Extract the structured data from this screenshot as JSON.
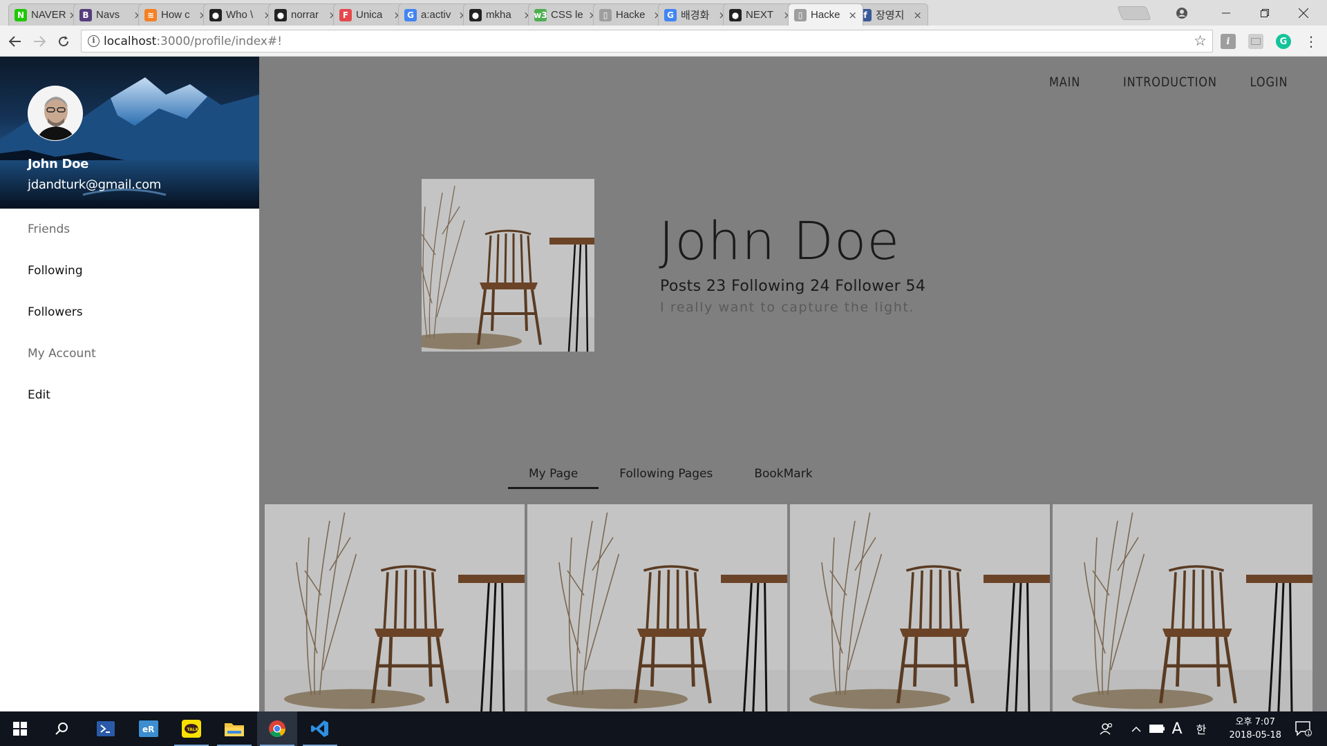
{
  "browser": {
    "tabs": [
      {
        "title": "NAVER",
        "favicon_text": "N",
        "favicon_color": "#1ec800"
      },
      {
        "title": "Navs",
        "favicon_text": "B",
        "favicon_color": "#563d7c"
      },
      {
        "title": "How c",
        "favicon_text": "≋",
        "favicon_color": "#f48024"
      },
      {
        "title": "Who \\",
        "favicon_text": "●",
        "favicon_color": "#222222"
      },
      {
        "title": "norrar",
        "favicon_text": "●",
        "favicon_color": "#222222"
      },
      {
        "title": "Unica",
        "favicon_text": "F",
        "favicon_color": "#e5484d"
      },
      {
        "title": "a:activ",
        "favicon_text": "G",
        "favicon_color": "#4285f4"
      },
      {
        "title": "mkha",
        "favicon_text": "●",
        "favicon_color": "#222222"
      },
      {
        "title": "CSS le",
        "favicon_text": "w3",
        "favicon_color": "#4caf50"
      },
      {
        "title": "Hacke",
        "favicon_text": "▯",
        "favicon_color": "#9e9e9e"
      },
      {
        "title": "배경화",
        "favicon_text": "G",
        "favicon_color": "#4285f4"
      },
      {
        "title": "NEXT",
        "favicon_text": "●",
        "favicon_color": "#222222"
      },
      {
        "title": "Hacke",
        "favicon_text": "▯",
        "favicon_color": "#9e9e9e"
      },
      {
        "title": "장영지",
        "favicon_text": "f",
        "favicon_color": "#3b5998"
      }
    ],
    "active_tab_index": 12,
    "url_host": "localhost",
    "url_path": ":3000/profile/index#!"
  },
  "sidebar": {
    "user_name": "John Doe",
    "user_email": "jdandturk@gmail.com",
    "items": [
      {
        "label": "Friends",
        "muted": true
      },
      {
        "label": "Following",
        "muted": false
      },
      {
        "label": "Followers",
        "muted": false
      },
      {
        "label": "My Account",
        "muted": true
      },
      {
        "label": "Edit",
        "muted": false
      }
    ]
  },
  "topnav": [
    "MAIN",
    "INTRODUCTION",
    "LOGIN"
  ],
  "profile": {
    "name": "John Doe",
    "stats": "Posts 23 Following 24 Follower 54",
    "bio": "I really want to capture the light."
  },
  "tabs": [
    {
      "label": "My Page",
      "active": true
    },
    {
      "label": "Following Pages",
      "active": false
    },
    {
      "label": "BookMark",
      "active": false
    }
  ],
  "taskbar": {
    "clock_time": "오후 7:07",
    "clock_date": "2018-05-18",
    "ime_letter": "A",
    "ime_lang": "한",
    "notification_count": "1"
  },
  "colors": {
    "sidebar_bg": "#ffffff",
    "main_overlay": "#7f7f7f",
    "taskbar_bg": "#0f141d"
  }
}
